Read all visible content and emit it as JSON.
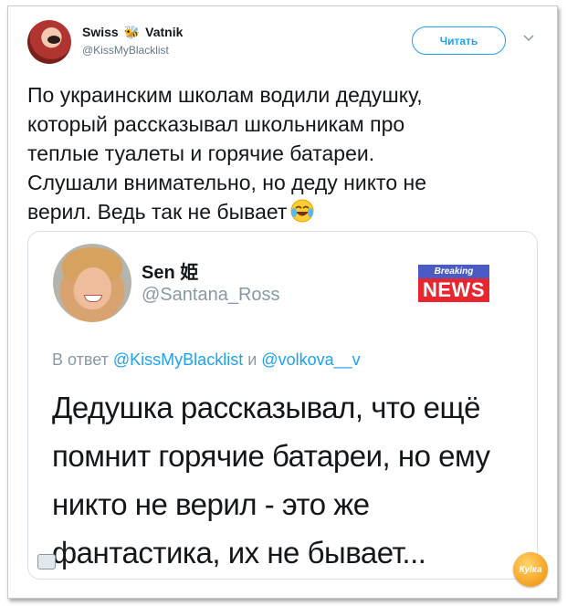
{
  "outer_tweet": {
    "author_name_part1": "Swiss",
    "author_name_part2": "Vatnik",
    "author_handle": "@KissMyBlacklist",
    "follow_label": "Читать",
    "text_lines": [
      "По украинским школам водили дедушку,",
      "который рассказывал школьникам про",
      "теплые туалеты и горячие батареи.",
      "Слушали внимательно, но деду никто не",
      "верил. Ведь так не бывает"
    ],
    "emoji": "tears-of-joy-emoji"
  },
  "quoted_tweet": {
    "author_name": "Sen 姫",
    "author_handle": "@Santana_Ross",
    "badge_top": "Breaking",
    "badge_bottom": "NEWS",
    "reply_prefix": "В ответ",
    "reply_mention_1": "@KissMyBlacklist",
    "reply_joiner": "и",
    "reply_mention_2": "@volkova__v",
    "text_lines": [
      "Дедушка рассказывал, что ещё",
      "помнит горячие батареи, но ему",
      "никто не верил - это же",
      "фантастика, их не бывает..."
    ]
  },
  "watermark_text": "Куlка",
  "colors": {
    "accent": "#1da1f2",
    "muted": "#8899a6",
    "text": "#14171a",
    "news_red": "#e8262f",
    "news_blue": "#4a5bc4"
  }
}
